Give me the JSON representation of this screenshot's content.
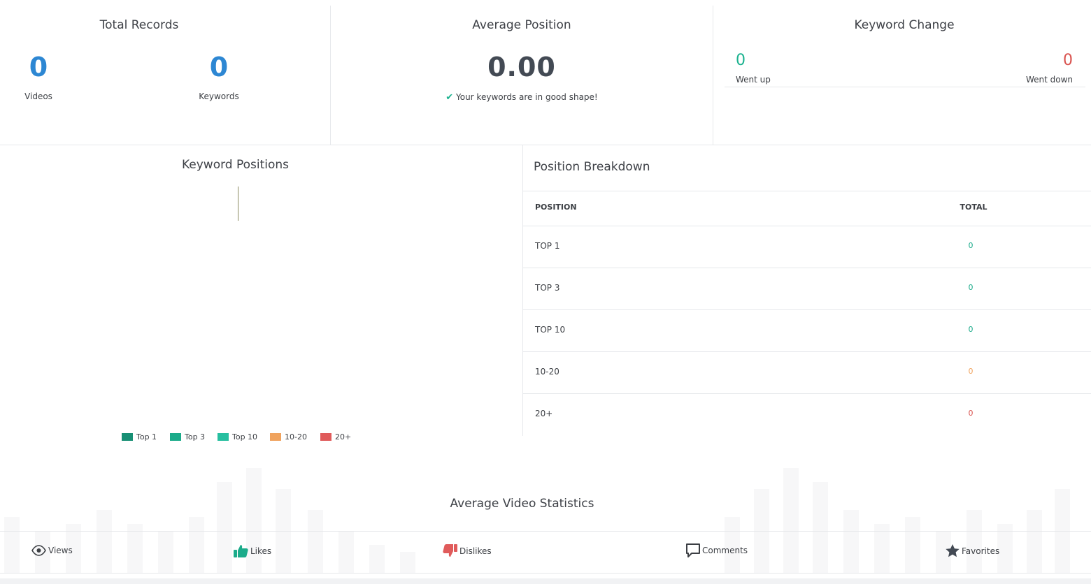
{
  "total_records": {
    "title": "Total Records",
    "videos": {
      "value": "0",
      "label": "Videos"
    },
    "keywords": {
      "value": "0",
      "label": "Keywords"
    }
  },
  "average_position": {
    "title": "Average Position",
    "value": "0.00",
    "status_text": "Your keywords are in good shape!"
  },
  "keyword_change": {
    "title": "Keyword Change",
    "went_up": {
      "value": "0",
      "label": "Went up",
      "color": "#1bb28f"
    },
    "went_down": {
      "value": "0",
      "label": "Went down",
      "color": "#d9534f"
    }
  },
  "keyword_positions": {
    "title": "Keyword Positions",
    "legend": [
      {
        "label": "Top 1",
        "color": "#178f74"
      },
      {
        "label": "Top 3",
        "color": "#1bab8a"
      },
      {
        "label": "Top 10",
        "color": "#27bfa0"
      },
      {
        "label": "10-20",
        "color": "#f0a35e"
      },
      {
        "label": "20+",
        "color": "#e05b5b"
      }
    ]
  },
  "position_breakdown": {
    "title": "Position Breakdown",
    "columns": [
      "POSITION",
      "TOTAL"
    ],
    "rows": [
      {
        "position": "TOP 1",
        "total": "0",
        "color": "#1bab8a"
      },
      {
        "position": "TOP 3",
        "total": "0",
        "color": "#1bab8a"
      },
      {
        "position": "TOP 10",
        "total": "0",
        "color": "#1bab8a"
      },
      {
        "position": "10-20",
        "total": "0",
        "color": "#f0a35e"
      },
      {
        "position": "20+",
        "total": "0",
        "color": "#d9534f"
      }
    ]
  },
  "video_stats": {
    "title": "Average Video Statistics",
    "items": [
      {
        "label": "Views",
        "icon": "eye-icon"
      },
      {
        "label": "Likes",
        "icon": "thumbs-up-icon"
      },
      {
        "label": "Dislikes",
        "icon": "thumbs-down-icon"
      },
      {
        "label": "Comments",
        "icon": "comment-icon"
      },
      {
        "label": "Favorites",
        "icon": "star-icon"
      }
    ]
  }
}
